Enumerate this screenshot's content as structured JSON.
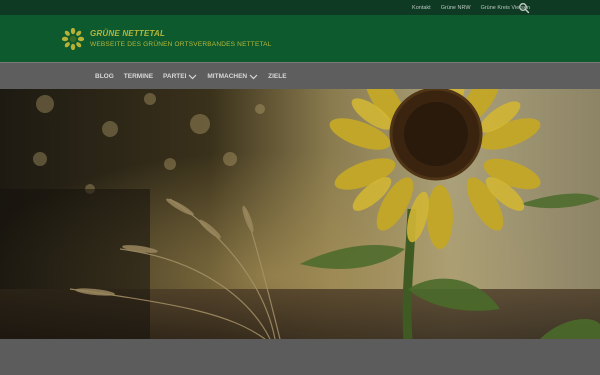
{
  "topbar": {
    "links": [
      "Kontakt",
      "Grüne NRW",
      "Grüne Kreis Viersen"
    ]
  },
  "header": {
    "title": "GRÜNE NETTETAL",
    "subtitle": "WEBSEITE DES GRÜNEN ORTSVERBANDES NETTETAL"
  },
  "nav": {
    "items": [
      {
        "label": "BLOG"
      },
      {
        "label": "TERMINE"
      },
      {
        "label": "PARTEI"
      },
      {
        "label": "MITMACHEN"
      },
      {
        "label": "ZIELE"
      }
    ]
  },
  "colors": {
    "topbar": "#0e3a24",
    "header": "#0d5a2f",
    "brand_text": "#b6b63a",
    "nav_bg": "#5e5e5e"
  },
  "icons": {
    "search": "search-icon",
    "logo": "sunflower-logo-icon",
    "dropdown": "chevron-down-icon"
  }
}
